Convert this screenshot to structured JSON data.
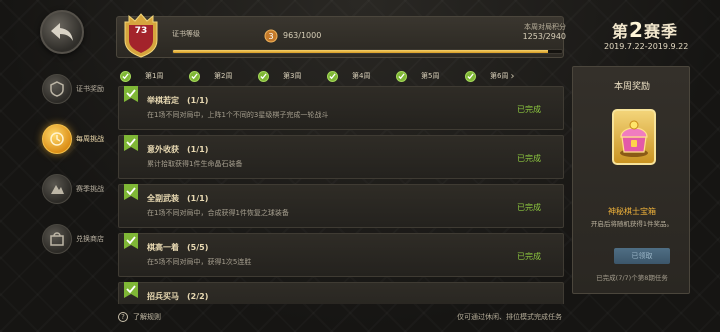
{
  "sidebar": {
    "items": [
      {
        "label": "证书奖励",
        "icon": "certificate-icon",
        "active": false
      },
      {
        "label": "每周挑战",
        "icon": "weekly-challenge-icon",
        "active": true
      },
      {
        "label": "赛季挑战",
        "icon": "season-challenge-icon",
        "active": false
      },
      {
        "label": "兑换商店",
        "icon": "shop-icon",
        "active": false
      }
    ]
  },
  "header": {
    "rank": "73",
    "cert_label": "证书等级",
    "xp": "963/1000",
    "xp_fraction": 0.963,
    "week_score_label": "本周对局积分",
    "week_score": "1253/2940"
  },
  "season": {
    "prefix": "第",
    "number": "2",
    "suffix": "赛季",
    "dates": "2019.7.22-2019.9.22"
  },
  "week_tabs": [
    {
      "label": "第1周"
    },
    {
      "label": "第2周"
    },
    {
      "label": "第3周"
    },
    {
      "label": "第4周"
    },
    {
      "label": "第5周"
    },
    {
      "label": "第6周"
    }
  ],
  "tasks": [
    {
      "title": "举棋若定",
      "count": "(1/1)",
      "desc": "在1场不同对局中，上阵1个不同的3星级棋子完成一轮战斗",
      "status": "已完成"
    },
    {
      "title": "意外收获",
      "count": "(1/1)",
      "desc": "累计拾取获得1件生命晶石装备",
      "status": "已完成"
    },
    {
      "title": "全副武装",
      "count": "(1/1)",
      "desc": "在1场不同对局中，合成获得1件恢复之球装备",
      "status": "已完成"
    },
    {
      "title": "棋高一着",
      "count": "(5/5)",
      "desc": "在5场不同对局中，获得1次5连胜",
      "status": "已完成"
    },
    {
      "title": "招兵买马",
      "count": "(2/2)",
      "desc": "",
      "status": ""
    }
  ],
  "footer": {
    "help": "了解规则",
    "hint": "仅可通过休闲、排位模式完成任务"
  },
  "reward": {
    "title": "本周奖励",
    "name": "神秘棋士宝箱",
    "desc": "开启后将随机获得1件奖品。",
    "button": "已领取",
    "note": "已完成(7/7)个第8期任务"
  },
  "colors": {
    "accent_gold": "#f0b23a",
    "done_green": "#8cc63f",
    "progress": "#e8b545"
  }
}
